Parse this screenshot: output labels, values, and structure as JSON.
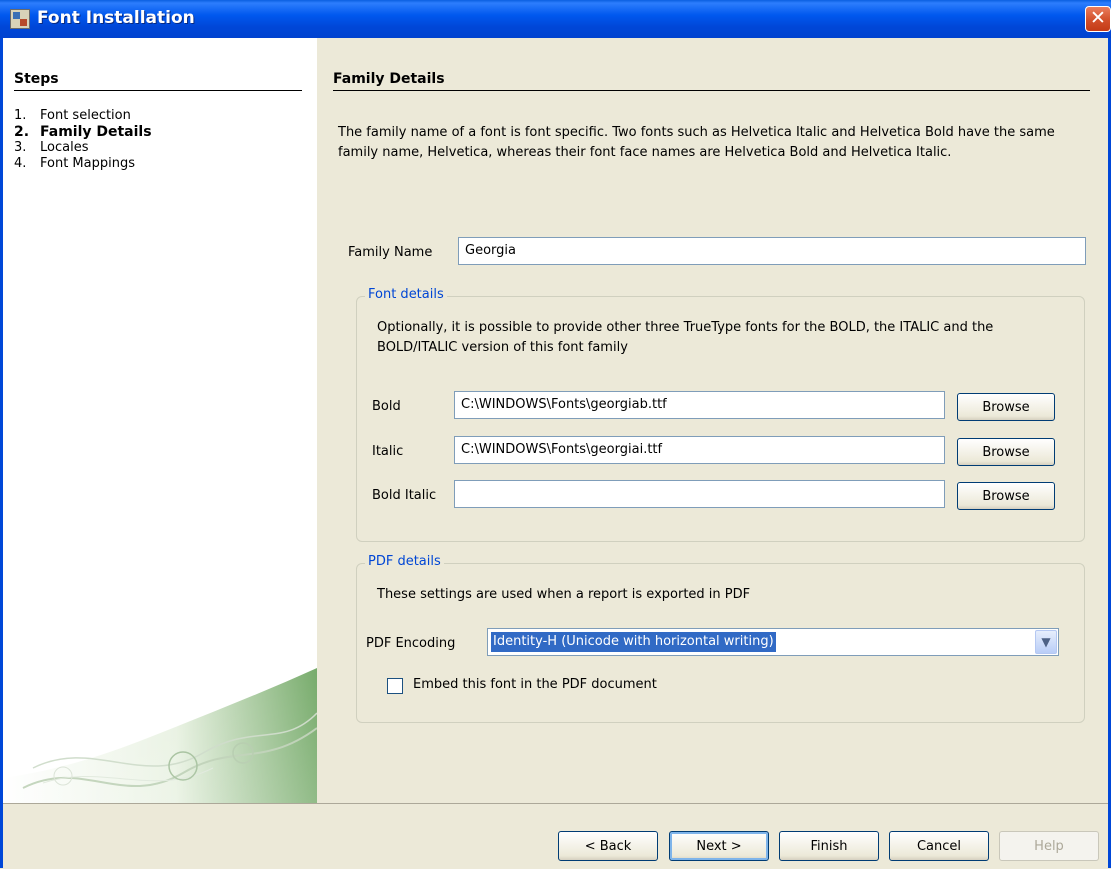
{
  "window": {
    "title": "Font Installation",
    "close_glyph": "✕"
  },
  "steps": {
    "header": "Steps",
    "items": [
      {
        "num": "1.",
        "label": "Font selection"
      },
      {
        "num": "2.",
        "label": "Family Details"
      },
      {
        "num": "3.",
        "label": "Locales"
      },
      {
        "num": "4.",
        "label": "Font Mappings"
      }
    ],
    "current_index": 1
  },
  "panel": {
    "header": "Family Details",
    "description": "The family name of a font is font specific. Two fonts such as Helvetica Italic and Helvetica Bold have the same family name, Helvetica, whereas their font face names are Helvetica Bold and Helvetica Italic.",
    "family_name_label": "Family Name",
    "family_name_value": "Georgia"
  },
  "font_details": {
    "title": "Font details",
    "text": "Optionally, it is possible to provide other three TrueType fonts for the BOLD, the ITALIC and the BOLD/ITALIC version of this font family",
    "rows": [
      {
        "label": "Bold",
        "value": "C:\\WINDOWS\\Fonts\\georgiab.ttf",
        "button": "Browse"
      },
      {
        "label": "Italic",
        "value": "C:\\WINDOWS\\Fonts\\georgiai.ttf",
        "button": "Browse"
      },
      {
        "label": "Bold Italic",
        "value": "",
        "button": "Browse"
      }
    ]
  },
  "pdf_details": {
    "title": "PDF details",
    "text": "These settings are used when a report is exported in PDF",
    "encoding_label": "PDF Encoding",
    "encoding_value": "Identity-H (Unicode with horizontal writing)",
    "embed_label": "Embed this font in the PDF document",
    "embed_checked": false
  },
  "buttons": {
    "back": "< Back",
    "next": "Next >",
    "finish": "Finish",
    "cancel": "Cancel",
    "help": "Help"
  },
  "colors": {
    "title_bar": "#0047d8",
    "group_title": "#0046d5",
    "selection": "#316ac5",
    "close_button": "#d24f2a"
  },
  "icons": [
    "app-icon",
    "close-icon",
    "dropdown-arrow-icon",
    "checkbox-icon"
  ]
}
